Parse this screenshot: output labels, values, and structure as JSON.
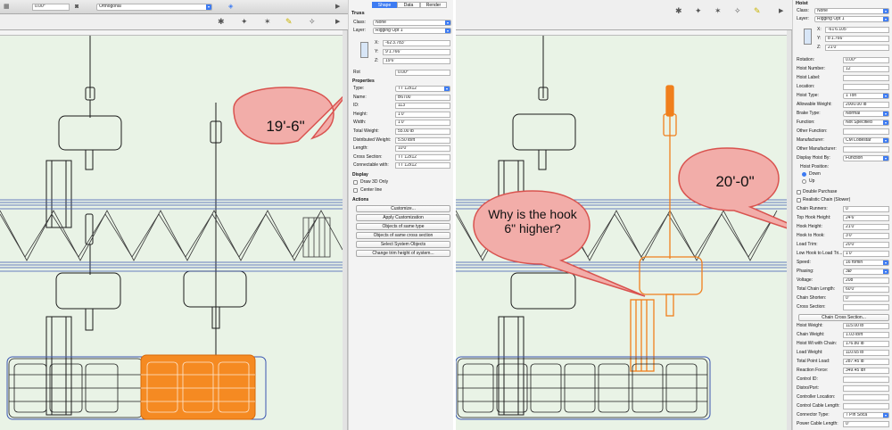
{
  "left": {
    "toolbar": {
      "angle": "0.00°",
      "view": "Orthogonal"
    },
    "obj_info": {
      "tabs": [
        "Shape",
        "Data",
        "Render"
      ],
      "title": "Truss",
      "class_label": "Class:",
      "class_value": "None",
      "layer_label": "Layer:",
      "layer_value": "Rigging Opt 1",
      "x_label": "X:",
      "x_value": "-62'3.783\"",
      "y_label": "Y:",
      "y_value": "9'1.766\"",
      "z_label": "Z:",
      "z_value": "19'6\"",
      "rotation_label": "Rot",
      "rotation_value": "0.00°",
      "properties_header": "Properties",
      "rows": [
        {
          "label": "Type:",
          "value": "TT 12x12"
        },
        {
          "label": "Name:",
          "value": "B6700"
        },
        {
          "label": "ID:",
          "value": "113"
        },
        {
          "label": "Height:",
          "value": "1'0\""
        },
        {
          "label": "Width:",
          "value": "1'0\""
        },
        {
          "label": "Total Weight:",
          "value": "55.00 lb"
        },
        {
          "label": "Distributed Weight:",
          "value": "5.50 lb/ft"
        },
        {
          "label": "Length:",
          "value": "10'0\""
        },
        {
          "label": "Cross Section:",
          "value": "TT 12x12"
        },
        {
          "label": "Connectable with:",
          "value": "TT 12x12"
        }
      ],
      "display_header": "Display",
      "display_checks": [
        "Draw 3D Only",
        "Center line"
      ],
      "actions_header": "Actions",
      "actions": [
        "Customize...",
        "Apply Customization",
        "Objects of same type",
        "Objects of same cross section",
        "Select System Objects",
        "Change trim height of system..."
      ]
    },
    "callout": "19'-6\""
  },
  "right": {
    "obj_info": {
      "title": "Hoist",
      "class_label": "Class:",
      "class_value": "None",
      "layer_label": "Layer:",
      "layer_value": "Rigging Opt 1",
      "x_label": "X:",
      "x_value": "-61'6.105\"",
      "y_label": "Y:",
      "y_value": "8'1.766\"",
      "z_label": "Z:",
      "z_value": "21'0\"",
      "rows_a": [
        {
          "label": "Rotation:",
          "value": "0.00°"
        },
        {
          "label": "Hoist Number:",
          "value": "12"
        },
        {
          "label": "Hoist Label:",
          "value": ""
        },
        {
          "label": "Location:",
          "value": ""
        },
        {
          "label": "Hoist Type:",
          "value": "1 Ton"
        },
        {
          "label": "Allowable Weight:",
          "value": "2000.00 lb"
        },
        {
          "label": "Brake Type:",
          "value": "Normal"
        },
        {
          "label": "Function:",
          "value": "Not Specified"
        },
        {
          "label": "Other Function:",
          "value": ""
        },
        {
          "label": "Manufacturer:",
          "value": "CM Lodestar"
        },
        {
          "label": "Other Manufacturer:",
          "value": ""
        },
        {
          "label": "Display Hoist By:",
          "value": "Function"
        }
      ],
      "hoist_position": "Hoist Position:",
      "pos_down": "Down",
      "pos_up": "Up",
      "checks": [
        "Double Purchase",
        "Realistic Chain (Slower)"
      ],
      "rows_b": [
        {
          "label": "Chain Runners:",
          "value": "0"
        },
        {
          "label": "Top Hook Height:",
          "value": "24'6\""
        },
        {
          "label": "Hook Height:",
          "value": "21'0\""
        },
        {
          "label": "Hook to Hook:",
          "value": "3'0\""
        },
        {
          "label": "Load Trim:",
          "value": "20'0\""
        },
        {
          "label": "Low Hook to Load Tri...",
          "value": "1'0\""
        },
        {
          "label": "Speed:",
          "value": "16 ft/min"
        },
        {
          "label": "Phasing:",
          "value": "3Ø"
        },
        {
          "label": "Voltage:",
          "value": "208"
        },
        {
          "label": "Total Chain Length:",
          "value": "60'0\""
        },
        {
          "label": "Chain Shorten:",
          "value": "0\""
        },
        {
          "label": "Cross Section:",
          "value": ""
        }
      ],
      "chain_btn": "Chain Cross Section...",
      "rows_c": [
        {
          "label": "Hoist Weight:",
          "value": "115.00 lb"
        },
        {
          "label": "Chain Weight:",
          "value": "1.03 lb/ft"
        },
        {
          "label": "Hoist Wt with Chain:",
          "value": "176.80 lb"
        },
        {
          "label": "Load Weight:",
          "value": "110.65 lb"
        },
        {
          "label": "Total Point Load:",
          "value": "287.45 lb"
        },
        {
          "label": "Reaction Force:",
          "value": "349.45 lbf"
        },
        {
          "label": "Control ID:",
          "value": ""
        },
        {
          "label": "Distro/Port:",
          "value": ""
        },
        {
          "label": "Controller Location:",
          "value": ""
        },
        {
          "label": "Control Cable Length:",
          "value": ""
        },
        {
          "label": "Connector Type:",
          "value": "7 Pin Soca"
        },
        {
          "label": "Power Cable Length:",
          "value": "0\""
        }
      ]
    },
    "callout_height": "20'-0\"",
    "callout_question": "Why is the hook 6\" higher?"
  },
  "colors": {
    "accent": "#3d7bf2",
    "callout_fill": "#f2ada9",
    "callout_stroke": "#d9534f",
    "selection": "#f07f1d",
    "canvas": "#e9f3e6"
  }
}
